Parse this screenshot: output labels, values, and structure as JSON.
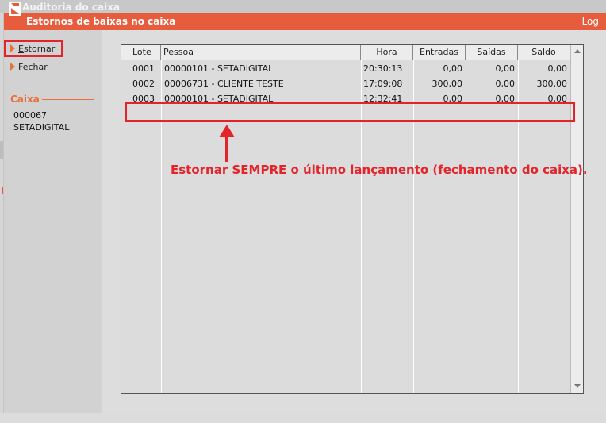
{
  "parent_window": {
    "title": "Auditoria do caixa"
  },
  "dialog": {
    "title": "Estornos de baixas no caixa",
    "log_label": "Log"
  },
  "actions": [
    {
      "label": "Estornar",
      "accel": "E",
      "rest": "stornar"
    },
    {
      "label": "Fechar"
    }
  ],
  "caixa": {
    "section_title": "Caixa",
    "code": "000067",
    "name": "SETADIGITAL"
  },
  "grid": {
    "columns": [
      "Lote",
      "Pessoa",
      "Hora",
      "Entradas",
      "Saídas",
      "Saldo"
    ],
    "rows": [
      {
        "lote": "0001",
        "pessoa": "00000101 - SETADIGITAL",
        "hora": "20:30:13",
        "entradas": "0,00",
        "saidas": "0,00",
        "saldo": "0,00"
      },
      {
        "lote": "0002",
        "pessoa": "00006731 - CLIENTE TESTE",
        "hora": "17:09:08",
        "entradas": "300,00",
        "saidas": "0,00",
        "saldo": "300,00"
      },
      {
        "lote": "0003",
        "pessoa": "00000101 - SETADIGITAL",
        "hora": "12:32:41",
        "entradas": "0,00",
        "saidas": "0,00",
        "saldo": "0,00"
      }
    ]
  },
  "annotation": {
    "text": "Estornar SEMPRE o último lançamento (fechamento do caixa)."
  },
  "colors": {
    "accent": "#e85c3e",
    "highlight": "#e3242b"
  }
}
